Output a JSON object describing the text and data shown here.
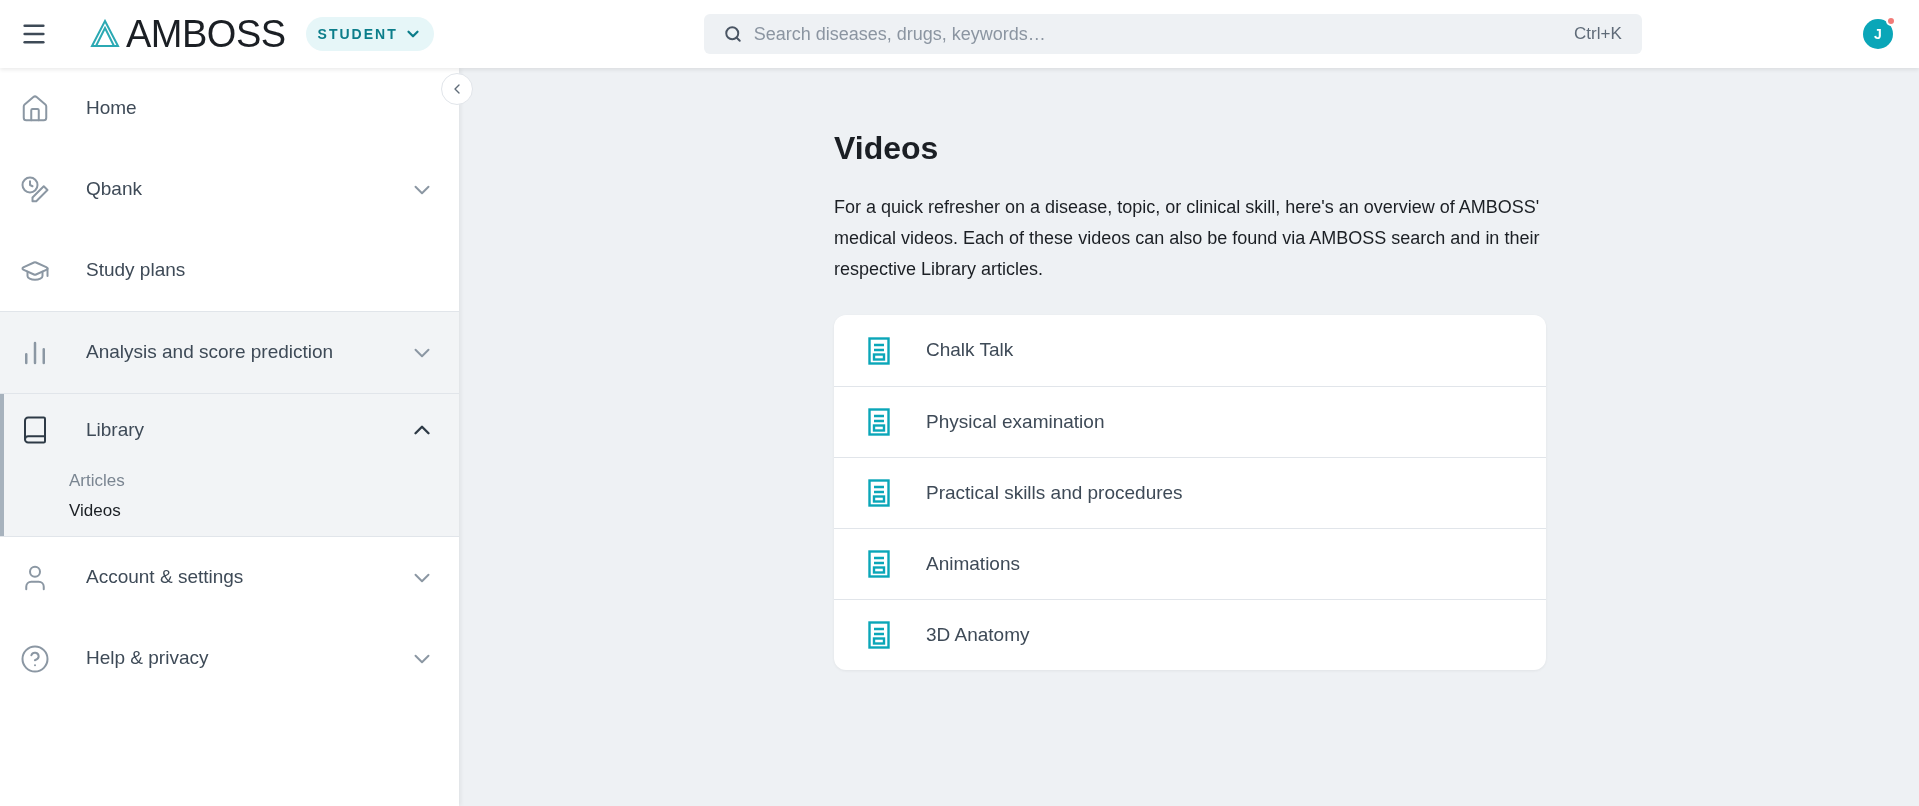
{
  "header": {
    "logo": "AMBOSS",
    "role_badge": "STUDENT",
    "search": {
      "placeholder": "Search diseases, drugs, keywords…",
      "shortcut": "Ctrl+K"
    },
    "avatar": {
      "initial": "J",
      "notification": true
    }
  },
  "sidebar": {
    "items": [
      {
        "label": "Home",
        "kind": "link",
        "active": false,
        "hovered": false
      },
      {
        "label": "Qbank",
        "kind": "group",
        "expanded": false,
        "active": false,
        "hovered": false
      },
      {
        "label": "Study plans",
        "kind": "link",
        "active": false,
        "hovered": false
      },
      {
        "label": "Analysis and score prediction",
        "kind": "group",
        "expanded": false,
        "active": false,
        "hovered": true
      },
      {
        "label": "Library",
        "kind": "group",
        "expanded": true,
        "active": true,
        "hovered": false,
        "children": [
          {
            "label": "Articles",
            "selected": false
          },
          {
            "label": "Videos",
            "selected": true
          }
        ]
      },
      {
        "label": "Account & settings",
        "kind": "group",
        "expanded": false,
        "active": false,
        "hovered": false
      },
      {
        "label": "Help & privacy",
        "kind": "group",
        "expanded": false,
        "active": false,
        "hovered": false
      }
    ]
  },
  "main": {
    "title": "Videos",
    "intro": "For a quick refresher on a disease, topic, or clinical skill, here's an overview of AMBOSS' medical videos. Each of these videos can also be found via AMBOSS search and in their respective Library articles.",
    "categories": [
      {
        "label": "Chalk Talk"
      },
      {
        "label": "Physical examination"
      },
      {
        "label": "Practical skills and procedures"
      },
      {
        "label": "Animations"
      },
      {
        "label": "3D Anatomy"
      }
    ]
  }
}
